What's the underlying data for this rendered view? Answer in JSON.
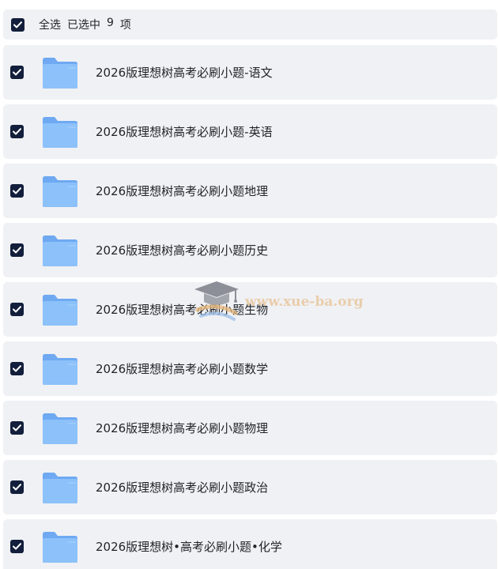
{
  "header": {
    "select_all_label": "全选",
    "selected_prefix": "已选中",
    "selected_count": "9",
    "selected_suffix": "项",
    "checked": true
  },
  "colors": {
    "row_background": "#f0f1f4",
    "checkbox": "#121e3b",
    "folder": "#7fb6f7",
    "text": "#1f2329"
  },
  "items": [
    {
      "label": "2026版理想树高考必刷小题-语文",
      "checked": true,
      "icon": "folder-icon"
    },
    {
      "label": "2026版理想树高考必刷小题-英语",
      "checked": true,
      "icon": "folder-icon"
    },
    {
      "label": "2026版理想树高考必刷小题地理",
      "checked": true,
      "icon": "folder-icon"
    },
    {
      "label": "2026版理想树高考必刷小题历史",
      "checked": true,
      "icon": "folder-icon"
    },
    {
      "label": "2026版理想树高考必刷小题生物",
      "checked": true,
      "icon": "folder-icon"
    },
    {
      "label": "2026版理想树高考必刷小题数学",
      "checked": true,
      "icon": "folder-icon"
    },
    {
      "label": "2026版理想树高考必刷小题物理",
      "checked": true,
      "icon": "folder-icon"
    },
    {
      "label": "2026版理想树高考必刷小题政治",
      "checked": true,
      "icon": "folder-icon"
    },
    {
      "label": "2026版理想树•高考必刷小题•化学",
      "checked": true,
      "icon": "folder-icon"
    }
  ],
  "watermark": {
    "text": "www.xue-ba.org",
    "icon": "graduation-cap-icon"
  }
}
